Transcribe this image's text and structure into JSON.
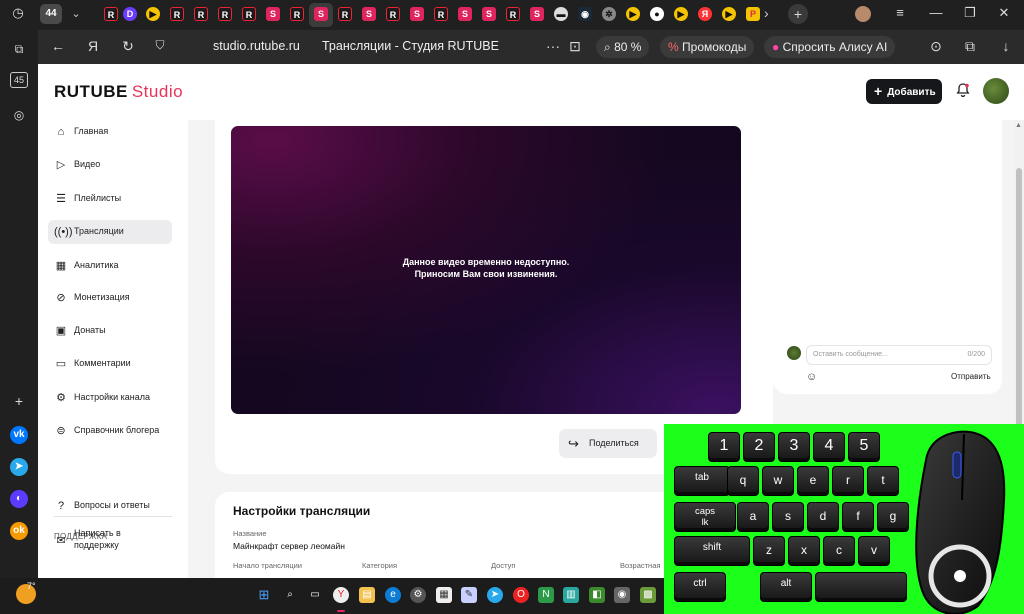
{
  "browser": {
    "tab_count": "44",
    "url": "studio.rutube.ru",
    "page_title": "Трансляции - Студия RUTUBE",
    "zoom": "80 %",
    "promo_label": "Промокоды",
    "alice_label": "Спросить Алису AI",
    "more_label": "···",
    "rail_badge": "45"
  },
  "site": {
    "logo_main": "RUTUBE",
    "logo_sub": "Studio",
    "add_button": "Добавить"
  },
  "sidebar": {
    "items": [
      {
        "label": "Главная",
        "icon": "home-icon"
      },
      {
        "label": "Видео",
        "icon": "video-icon"
      },
      {
        "label": "Плейлисты",
        "icon": "playlist-icon"
      },
      {
        "label": "Трансляции",
        "icon": "broadcast-icon",
        "active": true
      },
      {
        "label": "Аналитика",
        "icon": "analytics-icon"
      },
      {
        "label": "Монетизация",
        "icon": "money-icon"
      },
      {
        "label": "Донаты",
        "icon": "donate-icon"
      },
      {
        "label": "Комментарии",
        "icon": "comment-icon"
      },
      {
        "label": "Настройки канала",
        "icon": "gear-icon"
      },
      {
        "label": "Справочник блогера",
        "icon": "book-icon"
      }
    ],
    "support_heading": "ПОДДЕРЖКА",
    "support_items": [
      {
        "label": "Вопросы и ответы",
        "icon": "faq-icon"
      },
      {
        "label": "Написать в поддержку",
        "label_line1": "Написать в",
        "label_line2": "поддержку",
        "icon": "mail-icon"
      }
    ]
  },
  "player": {
    "message_line1": "Данное видео временно недоступно.",
    "message_line2": "Приносим Вам свои извинения.",
    "share_label": "Поделиться"
  },
  "chat": {
    "input_placeholder": "Оставить сообщение...",
    "char_count": "0/200",
    "send_label": "Отправить"
  },
  "settings": {
    "title": "Настройки трансляции",
    "name_label": "Название",
    "name_value": "Майнкрафт сервер леомайн",
    "start_label": "Начало трансляции",
    "category_label": "Категория",
    "access_label": "Доступ",
    "age_label": "Возрастная"
  },
  "overlay": {
    "number_keys": [
      "1",
      "2",
      "3",
      "4",
      "5"
    ],
    "row_tab": [
      "tab",
      "q",
      "w",
      "e",
      "r",
      "t"
    ],
    "row_caps": [
      "a",
      "s",
      "d",
      "f",
      "g"
    ],
    "caps_line1": "caps",
    "caps_line2": "lk",
    "row_shift": [
      "shift",
      "z",
      "x",
      "c",
      "v"
    ],
    "ctrl": "ctrl",
    "alt": "alt"
  },
  "taskbar": {
    "temperature": "7°"
  },
  "colors": {
    "accent": "#e8325a",
    "overlay_green": "#1bff1b",
    "player_bg": "#140820"
  }
}
